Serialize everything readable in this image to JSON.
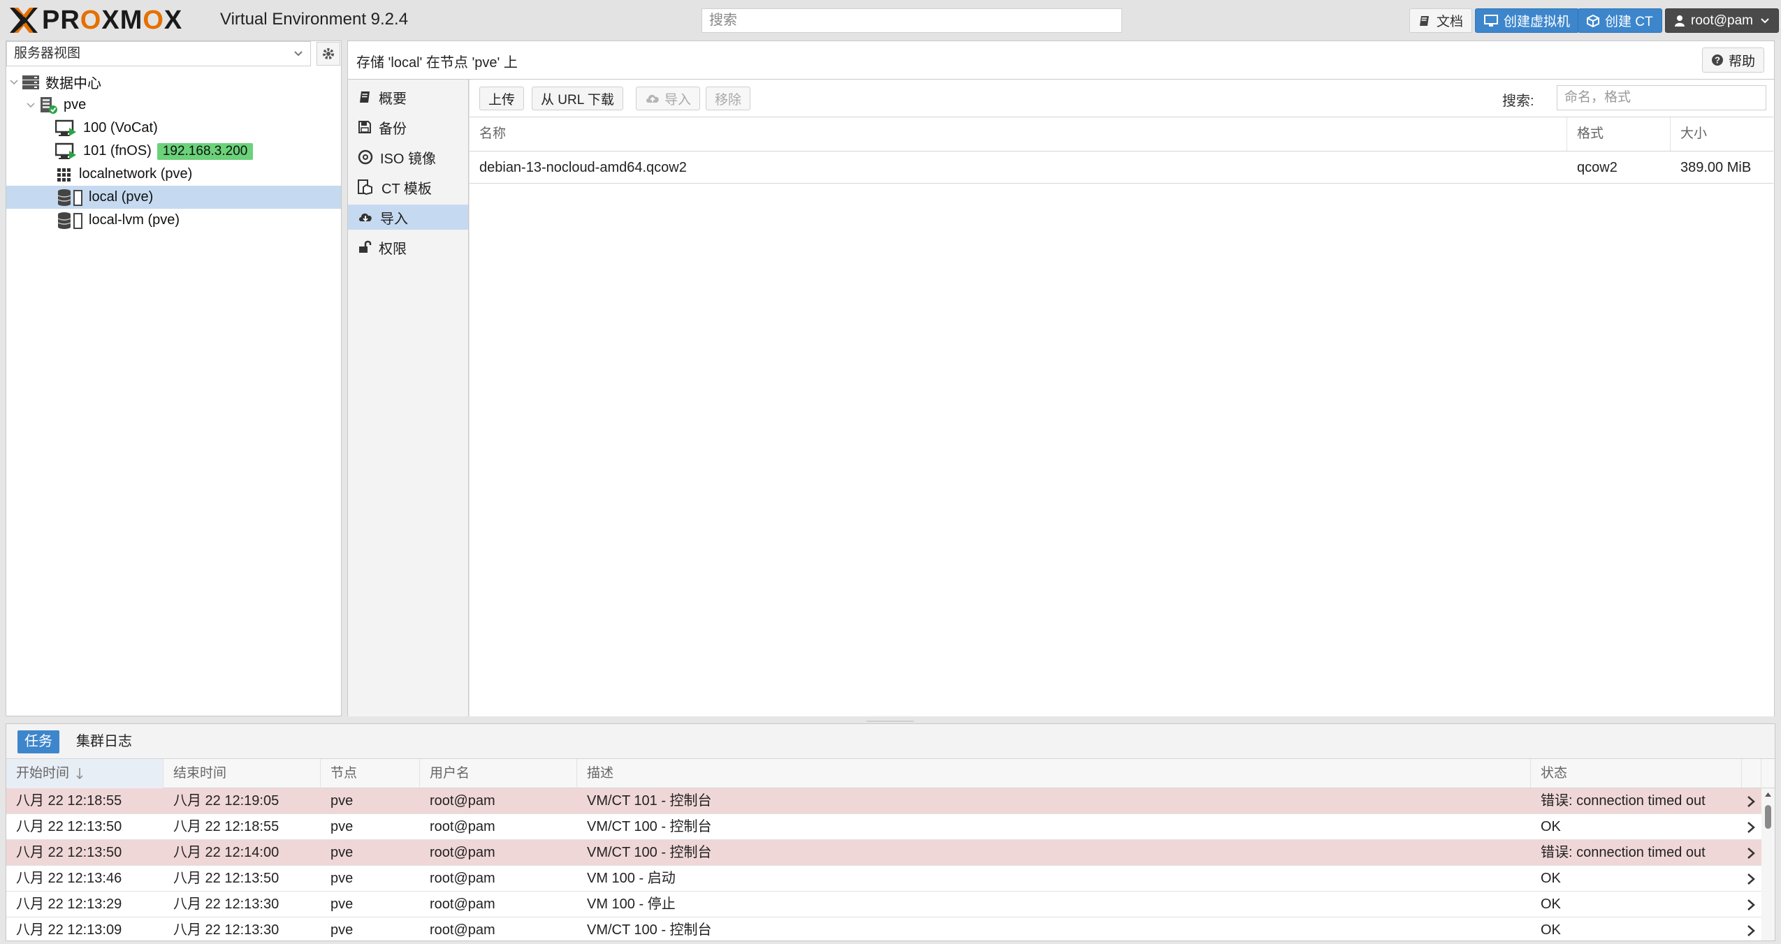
{
  "header": {
    "logo_text": "PROXMOX",
    "product": "Virtual Environment 9.2.4",
    "search_placeholder": "搜索",
    "docs_label": "文档",
    "create_vm_label": "创建虚拟机",
    "create_ct_label": "创建 CT",
    "user_label": "root@pam"
  },
  "sidebar": {
    "view_selector": "服务器视图",
    "tree": [
      {
        "label": "数据中心",
        "icon": "datacenter-icon"
      },
      {
        "label": "pve",
        "icon": "node-online-icon"
      },
      {
        "label": "100 (VoCat)",
        "icon": "vm-running-icon"
      },
      {
        "label": "101 (fnOS)",
        "icon": "vm-running-icon",
        "badge": "192.168.3.200"
      },
      {
        "label": "localnetwork (pve)",
        "icon": "sdn-grid-icon"
      },
      {
        "label": "local (pve)",
        "icon": "storage-icon",
        "selected": true
      },
      {
        "label": "local-lvm (pve)",
        "icon": "storage-icon"
      }
    ]
  },
  "content": {
    "title": "存储 'local' 在节点 'pve' 上",
    "help_label": "帮助",
    "nav": [
      {
        "label": "概要",
        "icon": "book-icon"
      },
      {
        "label": "备份",
        "icon": "floppy-icon"
      },
      {
        "label": "ISO 镜像",
        "icon": "disc-icon"
      },
      {
        "label": "CT 模板",
        "icon": "template-icon"
      },
      {
        "label": "导入",
        "icon": "cloud-download-icon",
        "active": true
      },
      {
        "label": "权限",
        "icon": "unlock-icon"
      }
    ],
    "toolbar": {
      "upload": "上传",
      "download_url": "从 URL 下载",
      "import": "导入",
      "remove": "移除",
      "search_label": "搜索:",
      "search_placeholder": "命名，格式"
    },
    "grid": {
      "columns": [
        "名称",
        "格式",
        "大小"
      ],
      "rows": [
        {
          "name": "debian-13-nocloud-amd64.qcow2",
          "format": "qcow2",
          "size": "389.00 MiB"
        }
      ]
    }
  },
  "tasks": {
    "tabs": [
      "任务",
      "集群日志"
    ],
    "columns": [
      "开始时间",
      "结束时间",
      "节点",
      "用户名",
      "描述",
      "状态"
    ],
    "rows": [
      {
        "start": "八月 22 12:18:55",
        "end": "八月 22 12:19:05",
        "node": "pve",
        "user": "root@pam",
        "desc": "VM/CT 101 - 控制台",
        "status": "错误: connection timed out",
        "error": true
      },
      {
        "start": "八月 22 12:13:50",
        "end": "八月 22 12:18:55",
        "node": "pve",
        "user": "root@pam",
        "desc": "VM/CT 100 - 控制台",
        "status": "OK",
        "error": false
      },
      {
        "start": "八月 22 12:13:50",
        "end": "八月 22 12:14:00",
        "node": "pve",
        "user": "root@pam",
        "desc": "VM/CT 100 - 控制台",
        "status": "错误: connection timed out",
        "error": true
      },
      {
        "start": "八月 22 12:13:46",
        "end": "八月 22 12:13:50",
        "node": "pve",
        "user": "root@pam",
        "desc": "VM 100 - 启动",
        "status": "OK",
        "error": false
      },
      {
        "start": "八月 22 12:13:29",
        "end": "八月 22 12:13:30",
        "node": "pve",
        "user": "root@pam",
        "desc": "VM 100 - 停止",
        "status": "OK",
        "error": false
      },
      {
        "start": "八月 22 12:13:09",
        "end": "八月 22 12:13:30",
        "node": "pve",
        "user": "root@pam",
        "desc": "VM/CT 100 - 控制台",
        "status": "OK",
        "error": false
      }
    ]
  },
  "colors": {
    "accent": "#3d86cc",
    "selection": "#c5daf0",
    "error_row": "#f0d7d7",
    "logo_orange": "#e57000",
    "ip_badge": "#6bd27a"
  }
}
